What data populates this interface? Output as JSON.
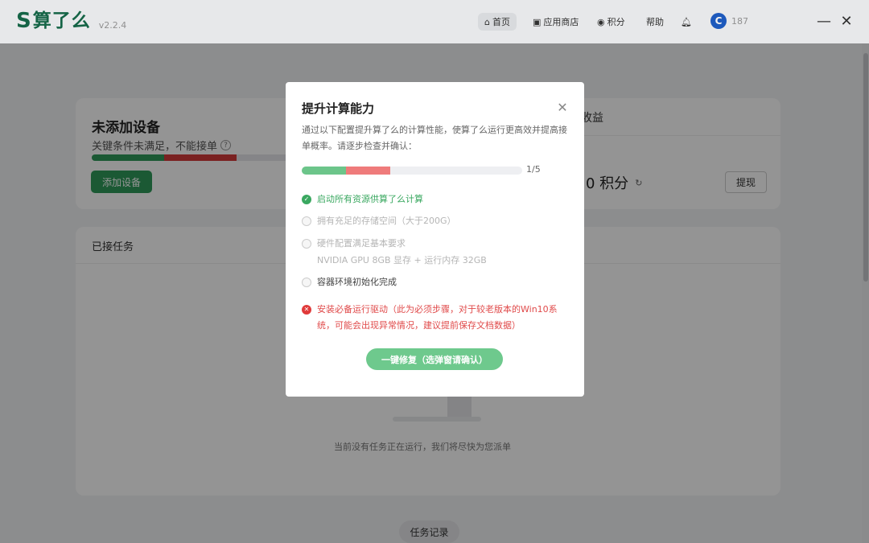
{
  "app": {
    "logo_mark": "S",
    "logo_text": "算了么",
    "version": "v2.2.4"
  },
  "nav": {
    "home": "首页",
    "store": "应用商店",
    "points": "积分",
    "help": "帮助",
    "user_id": "187"
  },
  "device_card": {
    "title": "未添加设备",
    "subtitle": "关键条件未满足，不能接单",
    "add_button": "添加设备"
  },
  "earnings_card": {
    "title": "收益",
    "value": "0 积分",
    "withdraw_button": "提现"
  },
  "tasks_card": {
    "title": "已接任务",
    "empty_text": "当前没有任务正在运行，我们将尽快为您派单",
    "record_button": "任务记录"
  },
  "modal": {
    "title": "提升计算能力",
    "description": "通过以下配置提升算了么的计算性能，使算了么运行更高效并提高接单概率。请逐步检查并确认：",
    "progress_value": 0.2,
    "progress_text": "1/5",
    "steps": [
      {
        "label": "启动所有资源供算了么计算",
        "status": "done"
      },
      {
        "label": "拥有充足的存储空间（大于200G）",
        "status": "todo"
      },
      {
        "label": "硬件配置满足基本要求",
        "sub": "NVIDIA GPU 8GB 显存 + 运行内存 32GB",
        "status": "todo"
      },
      {
        "label": "容器环境初始化完成",
        "status": "pending"
      },
      {
        "label": "安装必备运行驱动（此为必须步骤，对于较老版本的Win10系统，可能会出现异常情况，建议提前保存文档数据）",
        "status": "error"
      }
    ],
    "fix_button": "一键修复（选弹窗请确认）"
  },
  "colors": {
    "brand": "#176b4b",
    "success": "#3aa860",
    "error": "#e03a3a",
    "button_green": "#6ec98d"
  }
}
